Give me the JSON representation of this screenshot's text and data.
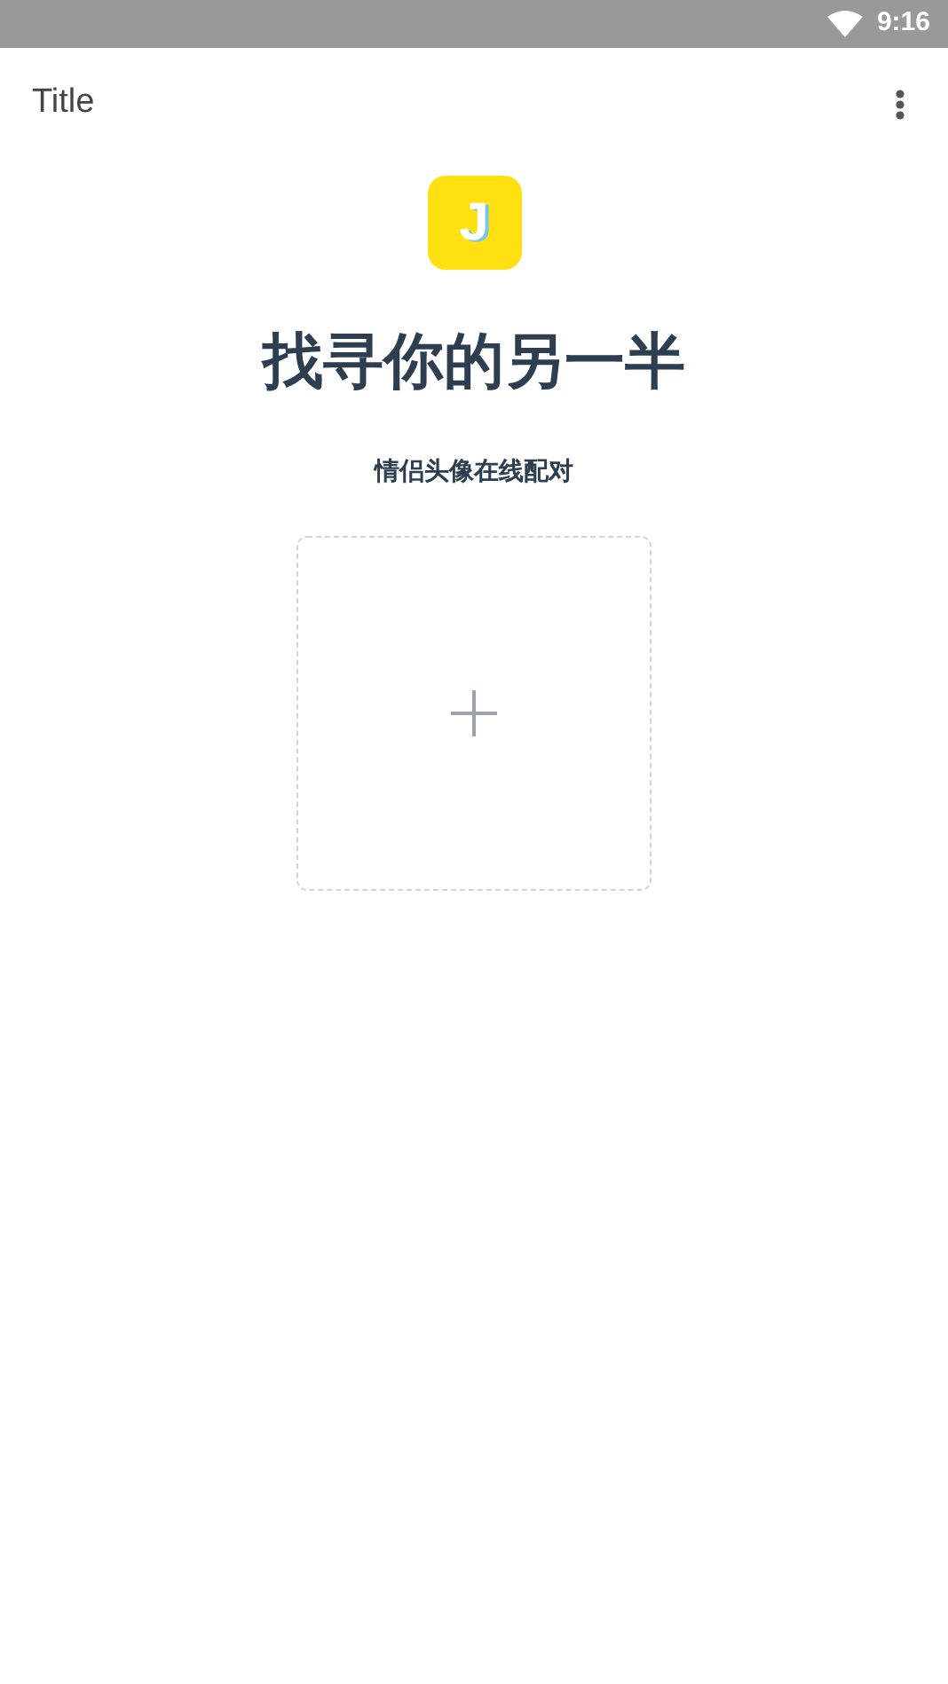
{
  "status_bar": {
    "time": "9:16"
  },
  "toolbar": {
    "title": "Title"
  },
  "logo": {
    "letter": "J"
  },
  "heading": "找寻你的另一半",
  "subtitle": "情侣头像在线配对",
  "upload": {
    "kind": "add"
  }
}
